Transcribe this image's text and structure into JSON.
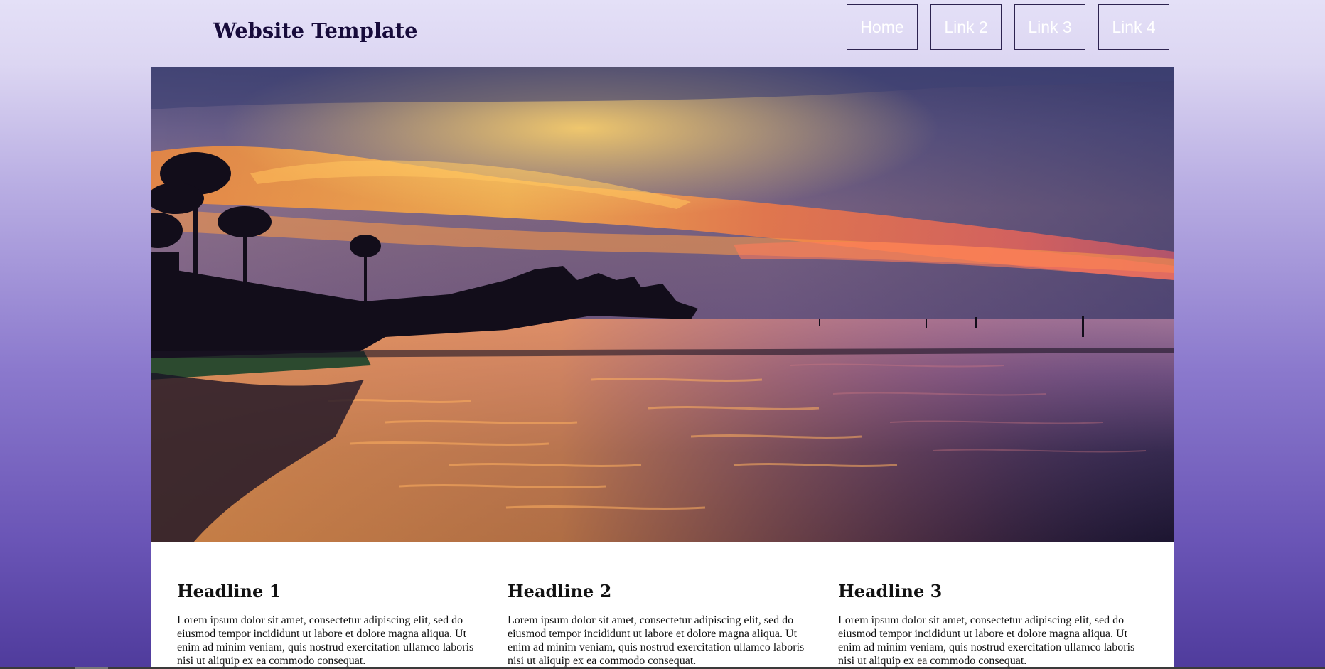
{
  "header": {
    "title": "Website Template"
  },
  "nav": {
    "links": [
      {
        "label": "Home"
      },
      {
        "label": "Link 2"
      },
      {
        "label": "Link 3"
      },
      {
        "label": "Link 4"
      }
    ]
  },
  "colors": {
    "title_text": "#170b3b",
    "nav_border": "#2d2350",
    "nav_text": "#ffffff",
    "content_bg": "#ffffff"
  },
  "columns": [
    {
      "headline": "Headline 1",
      "body": "Lorem ipsum dolor sit amet, consectetur adipiscing elit, sed do eiusmod tempor incididunt ut labore et dolore magna aliqua. Ut enim ad minim veniam, quis nostrud exercitation ullamco laboris nisi ut aliquip ex ea commodo consequat."
    },
    {
      "headline": "Headline 2",
      "body": "Lorem ipsum dolor sit amet, consectetur adipiscing elit, sed do eiusmod tempor incididunt ut labore et dolore magna aliqua. Ut enim ad minim veniam, quis nostrud exercitation ullamco laboris nisi ut aliquip ex ea commodo consequat."
    },
    {
      "headline": "Headline 3",
      "body": "Lorem ipsum dolor sit amet, consectetur adipiscing elit, sed do eiusmod tempor incididunt ut labore et dolore magna aliqua. Ut enim ad minim veniam, quis nostrud exercitation ullamco laboris nisi ut aliquip ex ea commodo consequat."
    }
  ]
}
